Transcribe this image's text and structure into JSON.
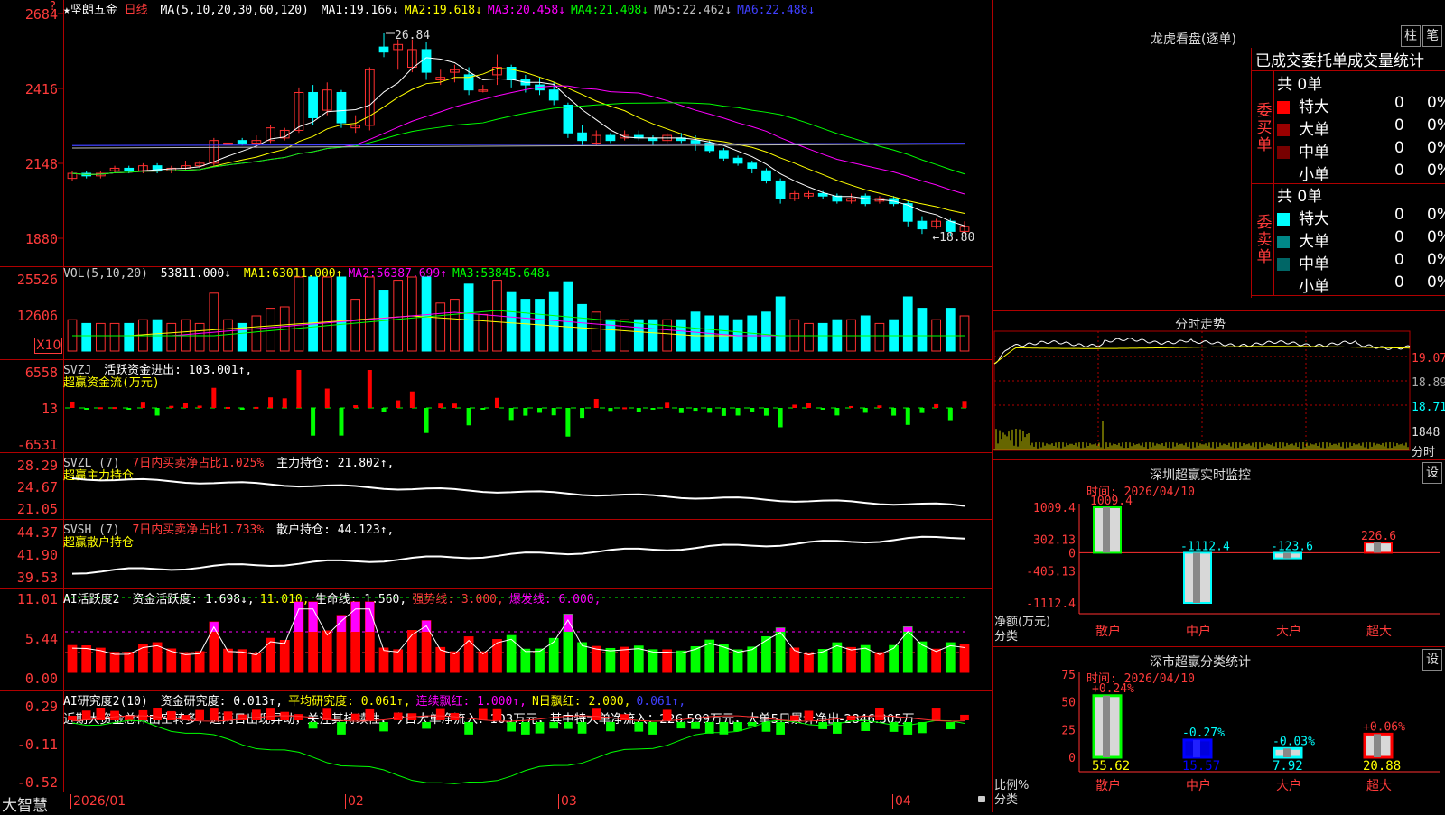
{
  "stock": {
    "name": "★坚朗五金",
    "period": "日线",
    "ma_params": "MA(5,10,20,30,60,120)",
    "ma_values": [
      {
        "label": "MA1:",
        "value": "19.166↓",
        "color": "#ffffff"
      },
      {
        "label": "MA2:",
        "value": "19.618↓",
        "color": "#ffff00"
      },
      {
        "label": "MA3:",
        "value": "20.458↓",
        "color": "#ff00ff"
      },
      {
        "label": "MA4:",
        "value": "21.408↓",
        "color": "#00ff00"
      },
      {
        "label": "MA5:",
        "value": "22.462↓",
        "color": "#c0c0c0"
      },
      {
        "label": "MA6:",
        "value": "22.488↓",
        "color": "#4040ff"
      }
    ],
    "high_label": "26.84",
    "low_label": "18.80",
    "price_ticks": [
      "2684",
      "2416",
      "2148",
      "1880"
    ],
    "price_marker": "?"
  },
  "vol": {
    "params": "VOL(5,10,20)",
    "value": "53811.000↓",
    "ma": [
      {
        "label": "MA1:",
        "value": "63011.000↑",
        "color": "#ffff00"
      },
      {
        "label": "MA2:",
        "value": "56387.699↑",
        "color": "#ff00ff"
      },
      {
        "label": "MA3:",
        "value": "53845.648↓",
        "color": "#00ff00"
      }
    ],
    "ticks": [
      "25526",
      "12606"
    ],
    "unit": "X10"
  },
  "svzj": {
    "name": "SVZJ",
    "line1": "活跃资金进出: 103.001↑,",
    "line2": "超赢资金流(万元)",
    "ticks": [
      "6558",
      "13",
      "-6531"
    ]
  },
  "svzl": {
    "name": "SVZL (7)",
    "text1": "7日内买卖净占比1.025%",
    "text2": "主力持仓: 21.802↑,",
    "line2": "超赢主力持仓",
    "ticks": [
      "28.29",
      "24.67",
      "21.05"
    ]
  },
  "svsh": {
    "name": "SVSH (7)",
    "text1": "7日内买卖净占比1.733%",
    "text2": "散户持仓: 44.123↑,",
    "line2": "超赢散户持仓",
    "ticks": [
      "44.37",
      "41.90",
      "39.53"
    ]
  },
  "ai1": {
    "name": "AI活跃度2",
    "items": [
      {
        "t": "资金活跃度: 1.698↓,",
        "c": "#ffffff"
      },
      {
        "t": "11.010,",
        "c": "#ffff00"
      },
      {
        "t": "生命线: 1.560,",
        "c": "#ffffff"
      },
      {
        "t": "强势线: 3.000,",
        "c": "#ff3b3b"
      },
      {
        "t": "爆发线: 6.000,",
        "c": "#ff00ff"
      }
    ],
    "ticks": [
      "11.01",
      "5.44",
      "0.00"
    ]
  },
  "ai2": {
    "name": "AI研究度2(10)",
    "items": [
      {
        "t": "资金研究度: 0.013↑,",
        "c": "#ffffff"
      },
      {
        "t": "平均研究度: 0.061↑,",
        "c": "#ffff00"
      },
      {
        "t": "连续飘红: 1.000↑,",
        "c": "#ff00ff"
      },
      {
        "t": "N日飘红: 2.000,",
        "c": "#ffff00"
      },
      {
        "t": "0.061↑,",
        "c": "#4040ff"
      }
    ],
    "comment": "近期大资金总体由空转多，近两日出现异动，关注其持续性，今日大单净流入：103万元，其中特大单净流入：226.599万元，大单5日累计净出-2846.305万",
    "ticks": [
      "0.29",
      "-0.11",
      "-0.52"
    ]
  },
  "xaxis": {
    "labels": [
      "2026/01",
      "02",
      "03",
      "04"
    ],
    "brand": "大智慧"
  },
  "right": {
    "lhb_title": "龙虎看盘(逐单)",
    "btn1": "柱",
    "btn2": "笔",
    "table_title": "已成交委托单成交量统计",
    "buy": {
      "side": "委买单",
      "total": "共 0单",
      "rows": [
        {
          "k": "特大",
          "v": "0",
          "p": "0%",
          "c": "#ff0000"
        },
        {
          "k": "大单",
          "v": "0",
          "p": "0%",
          "c": "#990000"
        },
        {
          "k": "中单",
          "v": "0",
          "p": "0%",
          "c": "#770000"
        },
        {
          "k": "小单",
          "v": "0",
          "p": "0%",
          "c": "#000000"
        }
      ]
    },
    "sell": {
      "side": "委卖单",
      "total": "共 0单",
      "rows": [
        {
          "k": "特大",
          "v": "0",
          "p": "0%",
          "c": "#00ffff"
        },
        {
          "k": "大单",
          "v": "0",
          "p": "0%",
          "c": "#008888"
        },
        {
          "k": "中单",
          "v": "0",
          "p": "0%",
          "c": "#006666"
        },
        {
          "k": "小单",
          "v": "0",
          "p": "0%",
          "c": "#000000"
        }
      ]
    },
    "intraday_title": "分时走势",
    "intraday_ticks": [
      "19.07",
      "18.89",
      "18.71",
      "1848",
      "分时"
    ],
    "mon_title": "深圳超赢实时监控",
    "mon_time": "时间: 2026/04/10",
    "mon_ylabel": "净额(万元)",
    "mon_xlabel": "分类",
    "mon_ticks": [
      "1009.4",
      "302.13",
      "0",
      "-405.13",
      "-1112.4"
    ],
    "cls_title": "深市超赢分类统计",
    "cls_time": "时间: 2026/04/10",
    "cls_ylabel": "比例%",
    "cls_xlabel": "分类",
    "cls_ticks": [
      "75",
      "50",
      "25",
      "0"
    ],
    "set_btn": "设"
  },
  "chart_data": [
    {
      "type": "bar",
      "title": "深圳超赢实时监控",
      "ylabel": "净额(万元)",
      "xlabel": "分类",
      "categories": [
        "散户",
        "中户",
        "大户",
        "超大"
      ],
      "values": [
        1009.4,
        -1112.4,
        -123.6,
        226.6
      ],
      "value_labels": [
        "1009.4",
        "-1112.4",
        "-123.6",
        "226.6"
      ],
      "ylim": [
        -1112.4,
        1009.4
      ]
    },
    {
      "type": "bar",
      "title": "深市超赢分类统计",
      "ylabel": "比例%",
      "xlabel": "分类",
      "categories": [
        "散户",
        "中户",
        "大户",
        "超大"
      ],
      "values": [
        55.62,
        15.57,
        7.92,
        20.88
      ],
      "value_labels": [
        "55.62",
        "15.57",
        "7.92",
        "20.88"
      ],
      "changes": [
        "+0.24%",
        "-0.27%",
        "-0.03%",
        "+0.06%"
      ],
      "ylim": [
        0,
        75
      ]
    },
    {
      "type": "line",
      "title": "坚朗五金 日线",
      "ylim": [
        18.8,
        26.84
      ],
      "x_labels": [
        "2026/01",
        "02",
        "03",
        "04"
      ],
      "candles": [
        [
          21.1,
          21.3,
          21.0,
          21.4
        ],
        [
          21.3,
          21.2,
          21.1,
          21.4
        ],
        [
          21.2,
          21.3,
          21.1,
          21.4
        ],
        [
          21.4,
          21.5,
          21.3,
          21.6
        ],
        [
          21.5,
          21.4,
          21.3,
          21.6
        ],
        [
          21.4,
          21.6,
          21.3,
          21.7
        ],
        [
          21.6,
          21.4,
          21.3,
          21.7
        ],
        [
          21.4,
          21.5,
          21.3,
          21.6
        ],
        [
          21.5,
          21.6,
          21.4,
          21.8
        ],
        [
          21.6,
          21.7,
          21.5,
          21.8
        ],
        [
          21.7,
          22.6,
          21.6,
          22.7
        ],
        [
          22.5,
          22.5,
          22.3,
          22.7
        ],
        [
          22.6,
          22.5,
          22.4,
          22.7
        ],
        [
          22.5,
          22.6,
          22.3,
          22.8
        ],
        [
          22.6,
          23.1,
          22.5,
          23.2
        ],
        [
          22.7,
          23.0,
          22.6,
          23.1
        ],
        [
          23.0,
          24.5,
          22.9,
          24.7
        ],
        [
          24.5,
          23.5,
          23.2,
          24.8
        ],
        [
          23.8,
          24.6,
          23.6,
          24.9
        ],
        [
          24.5,
          23.3,
          23.1,
          24.6
        ],
        [
          23.1,
          23.2,
          22.9,
          23.6
        ],
        [
          23.2,
          25.4,
          23.0,
          25.5
        ],
        [
          26.3,
          26.1,
          25.9,
          26.84
        ],
        [
          26.2,
          26.4,
          25.4,
          26.6
        ],
        [
          25.5,
          26.2,
          25.3,
          26.6
        ],
        [
          26.2,
          25.3,
          25.0,
          26.5
        ],
        [
          25.0,
          25.1,
          24.8,
          25.4
        ],
        [
          25.3,
          25.4,
          24.9,
          25.6
        ],
        [
          25.2,
          24.6,
          24.4,
          25.5
        ],
        [
          24.6,
          24.6,
          24.5,
          24.8
        ],
        [
          25.2,
          25.5,
          24.8,
          26.0
        ],
        [
          25.5,
          25.0,
          24.7,
          25.6
        ],
        [
          25.0,
          24.8,
          24.5,
          25.2
        ],
        [
          24.8,
          24.6,
          24.4,
          25.1
        ],
        [
          24.6,
          24.2,
          24.0,
          24.9
        ],
        [
          24.0,
          22.9,
          22.7,
          24.1
        ],
        [
          22.9,
          22.6,
          22.4,
          23.2
        ],
        [
          22.5,
          22.8,
          22.4,
          23.0
        ],
        [
          22.8,
          22.6,
          22.5,
          22.9
        ],
        [
          22.7,
          22.8,
          22.6,
          23.0
        ],
        [
          22.8,
          22.7,
          22.6,
          23.0
        ],
        [
          22.7,
          22.6,
          22.4,
          22.8
        ],
        [
          22.6,
          22.8,
          22.5,
          22.9
        ],
        [
          22.7,
          22.6,
          22.5,
          22.9
        ],
        [
          22.6,
          22.5,
          22.2,
          22.8
        ],
        [
          22.5,
          22.2,
          22.1,
          22.6
        ],
        [
          22.2,
          21.9,
          21.8,
          22.3
        ],
        [
          21.9,
          21.7,
          21.6,
          22.0
        ],
        [
          21.7,
          21.5,
          21.3,
          21.8
        ],
        [
          21.4,
          21.0,
          20.9,
          21.5
        ],
        [
          21.0,
          20.3,
          20.1,
          21.1
        ],
        [
          20.3,
          20.5,
          20.2,
          20.6
        ],
        [
          20.4,
          20.5,
          20.3,
          20.6
        ],
        [
          20.5,
          20.4,
          20.3,
          20.6
        ],
        [
          20.4,
          20.2,
          20.1,
          20.5
        ],
        [
          20.2,
          20.3,
          20.1,
          20.5
        ],
        [
          20.4,
          20.1,
          20.0,
          20.5
        ],
        [
          20.2,
          20.3,
          20.1,
          20.4
        ],
        [
          20.3,
          20.1,
          20.0,
          20.4
        ],
        [
          20.1,
          19.4,
          19.2,
          20.2
        ],
        [
          19.4,
          19.1,
          18.9,
          19.6
        ],
        [
          19.2,
          19.4,
          19.1,
          19.5
        ],
        [
          19.4,
          19.0,
          18.8,
          19.5
        ],
        [
          19.0,
          19.2,
          18.9,
          19.4
        ]
      ]
    }
  ]
}
